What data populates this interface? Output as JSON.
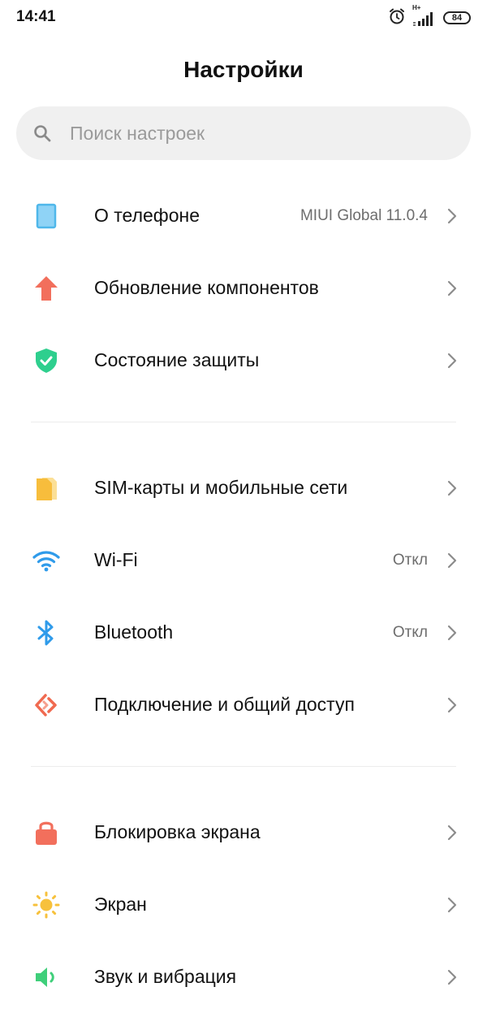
{
  "status_bar": {
    "time": "14:41",
    "network_type": "H+",
    "battery_level": "84"
  },
  "header": {
    "title": "Настройки"
  },
  "search": {
    "placeholder": "Поиск настроек",
    "value": ""
  },
  "groups": [
    {
      "items": [
        {
          "label": "О телефоне",
          "value": "MIUI Global 11.0.4",
          "icon": "phone-icon",
          "color": "#4fb7ea"
        },
        {
          "label": "Обновление компонентов",
          "value": "",
          "icon": "update-arrow-icon",
          "color": "#f26f5c"
        },
        {
          "label": "Состояние защиты",
          "value": "",
          "icon": "shield-check-icon",
          "color": "#2ecf8e"
        }
      ]
    },
    {
      "items": [
        {
          "label": "SIM-карты и мобильные сети",
          "value": "",
          "icon": "sim-card-icon",
          "color": "#f7bd3c"
        },
        {
          "label": "Wi-Fi",
          "value": "Откл",
          "icon": "wifi-icon",
          "color": "#2f9bea"
        },
        {
          "label": "Bluetooth",
          "value": "Откл",
          "icon": "bluetooth-icon",
          "color": "#2f9bea"
        },
        {
          "label": "Подключение и общий доступ",
          "value": "",
          "icon": "connection-sharing-icon",
          "color": "#f06a50"
        }
      ]
    },
    {
      "items": [
        {
          "label": "Блокировка экрана",
          "value": "",
          "icon": "lock-icon",
          "color": "#f26f5c"
        },
        {
          "label": "Экран",
          "value": "",
          "icon": "sun-icon",
          "color": "#f7c13c"
        },
        {
          "label": "Звук и вибрация",
          "value": "",
          "icon": "sound-icon",
          "color": "#3fcf7a"
        }
      ]
    }
  ]
}
